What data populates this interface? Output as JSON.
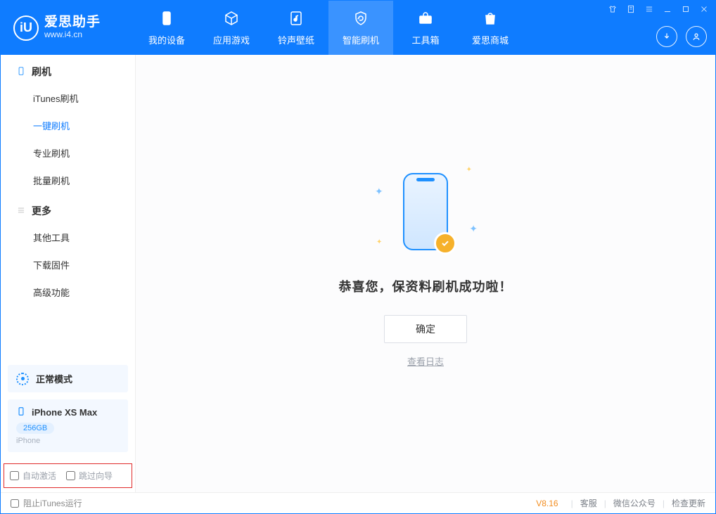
{
  "brand": {
    "name": "爱思助手",
    "url": "www.i4.cn",
    "logo_letter": "iU"
  },
  "nav": {
    "tabs": [
      {
        "label": "我的设备"
      },
      {
        "label": "应用游戏"
      },
      {
        "label": "铃声壁纸"
      },
      {
        "label": "智能刷机"
      },
      {
        "label": "工具箱"
      },
      {
        "label": "爱思商城"
      }
    ],
    "active_index": 3
  },
  "sidebar": {
    "groups": [
      {
        "title": "刷机",
        "icon": "phone-icon",
        "items": [
          {
            "label": "iTunes刷机"
          },
          {
            "label": "一键刷机"
          },
          {
            "label": "专业刷机"
          },
          {
            "label": "批量刷机"
          }
        ],
        "active_index": 1
      },
      {
        "title": "更多",
        "icon": "menu-icon",
        "items": [
          {
            "label": "其他工具"
          },
          {
            "label": "下载固件"
          },
          {
            "label": "高级功能"
          }
        ],
        "active_index": -1
      }
    ],
    "mode": {
      "label": "正常模式"
    },
    "device": {
      "name": "iPhone XS Max",
      "capacity": "256GB",
      "subtitle": "iPhone"
    },
    "checks": {
      "auto_activate": "自动激活",
      "skip_guide": "跳过向导"
    }
  },
  "main": {
    "success_text": "恭喜您，保资料刷机成功啦！",
    "ok_button": "确定",
    "view_log": "查看日志"
  },
  "footer": {
    "block_itunes": "阻止iTunes运行",
    "version": "V8.16",
    "links": {
      "service": "客服",
      "wechat": "微信公众号",
      "update": "检查更新"
    }
  }
}
